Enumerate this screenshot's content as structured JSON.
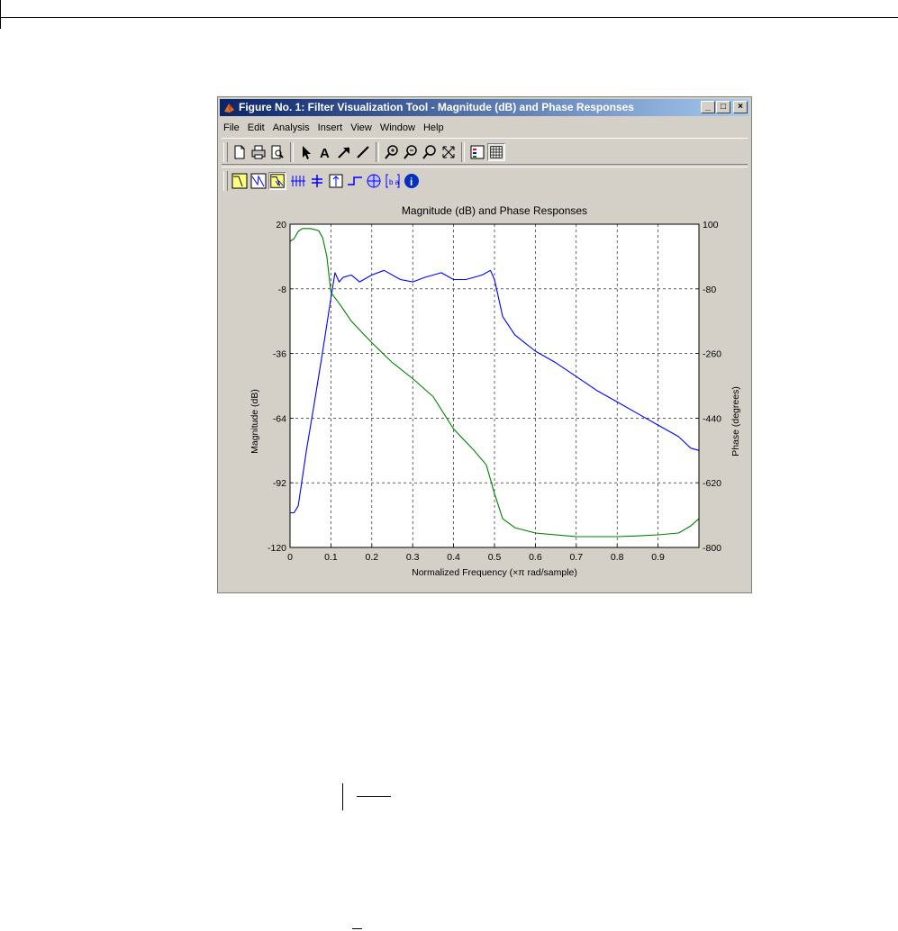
{
  "window": {
    "title": "Figure No. 1: Filter Visualization Tool - Magnitude (dB) and Phase Responses",
    "buttons": [
      "_",
      "□",
      "×"
    ]
  },
  "menu": [
    "File",
    "Edit",
    "Analysis",
    "Insert",
    "View",
    "Window",
    "Help"
  ],
  "toolbar1": [
    "new-icon",
    "print-icon",
    "print-preview-icon",
    "select-arrow-icon",
    "text-icon",
    "arrow-icon",
    "line-icon",
    "zoom-in-icon",
    "zoom-out-icon",
    "zoom-x-icon",
    "full-view-icon",
    "legend-icon",
    "grid-icon"
  ],
  "toolbar2": [
    "magnitude-response-icon",
    "phase-response-icon",
    "magnitude-phase-icon",
    "group-delay-icon",
    "phase-delay-icon",
    "impulse-response-icon",
    "step-response-icon",
    "pole-zero-icon",
    "coefficients-icon",
    "info-icon"
  ],
  "colors": {
    "magnitude": "#0000ff",
    "phase": "#008000",
    "accent": "#0a246a"
  },
  "chart_data": {
    "type": "line",
    "title": "Magnitude (dB) and Phase Responses",
    "xlabel": "Normalized Frequency (×π rad/sample)",
    "ylabel": "Magnitude (dB)",
    "y2label": "Phase (degrees)",
    "xlim": [
      0,
      1
    ],
    "ylim": [
      -120,
      20
    ],
    "y2lim": [
      -800,
      100
    ],
    "xticks": [
      "0",
      "0.1",
      "0.2",
      "0.3",
      "0.4",
      "0.5",
      "0.6",
      "0.7",
      "0.8",
      "0.9"
    ],
    "yticks": [
      "20",
      "-8",
      "-36",
      "-64",
      "-92",
      "-120"
    ],
    "y2ticks": [
      "100",
      "-80",
      "-260",
      "-440",
      "-620",
      "-800"
    ],
    "grid": true,
    "series": [
      {
        "axis": "left",
        "color": "#0000ff",
        "x": [
          0,
          0.01,
          0.02,
          0.04,
          0.06,
          0.08,
          0.1,
          0.11,
          0.12,
          0.13,
          0.15,
          0.17,
          0.2,
          0.23,
          0.27,
          0.3,
          0.33,
          0.37,
          0.4,
          0.43,
          0.45,
          0.47,
          0.49,
          0.5,
          0.52,
          0.55,
          0.6,
          0.65,
          0.7,
          0.75,
          0.8,
          0.85,
          0.9,
          0.95,
          0.98,
          1.0
        ],
        "y": [
          -105,
          -105,
          -102,
          -78,
          -57,
          -35,
          -12,
          -1,
          -5,
          -3,
          -2,
          -5,
          -2,
          0,
          -4,
          -5,
          -3,
          -1,
          -4,
          -4,
          -3,
          -2,
          0,
          -4,
          -20,
          -28,
          -35,
          -40,
          -46,
          -52,
          -57,
          -62,
          -67,
          -72,
          -77,
          -78
        ]
      },
      {
        "axis": "right",
        "color": "#008000",
        "x": [
          0,
          0.01,
          0.02,
          0.03,
          0.05,
          0.07,
          0.08,
          0.09,
          0.1,
          0.12,
          0.15,
          0.2,
          0.25,
          0.3,
          0.35,
          0.4,
          0.45,
          0.48,
          0.5,
          0.52,
          0.55,
          0.6,
          0.7,
          0.8,
          0.85,
          0.9,
          0.95,
          0.98,
          1.0
        ],
        "y": [
          52,
          60,
          80,
          88,
          88,
          82,
          62,
          10,
          -90,
          -120,
          -170,
          -230,
          -285,
          -330,
          -380,
          -470,
          -530,
          -570,
          -650,
          -720,
          -745,
          -760,
          -770,
          -770,
          -768,
          -765,
          -760,
          -740,
          -720
        ]
      }
    ]
  }
}
